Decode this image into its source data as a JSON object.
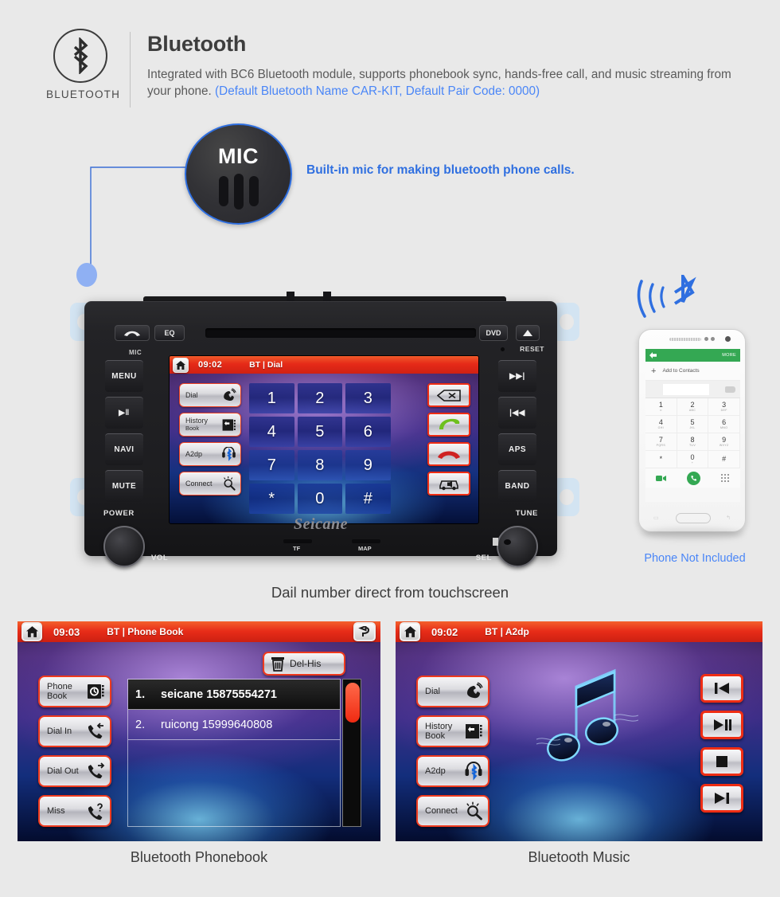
{
  "header": {
    "icon_name": "bluetooth-icon",
    "icon_word": "BLUETOOTH",
    "title": "Bluetooth",
    "desc_main": "Integrated with BC6 Bluetooth module, supports phonebook sync, hands-free call, and music streaming from your phone. ",
    "desc_accent": "(Default Bluetooth Name CAR-KIT, Default Pair Code: 0000)",
    "accent_color": "#4a86f7"
  },
  "mic": {
    "label": "MIC",
    "caption": "Built-in mic for making bluetooth phone calls.",
    "caption_color": "#2f6fe0"
  },
  "unit": {
    "brand": "Seicane",
    "caption": "Dail number direct from touchscreen",
    "mic_hole_label": "MIC",
    "reset_label": "RESET",
    "top_buttons": [
      {
        "name": "hangup-button",
        "label": ""
      },
      {
        "name": "eq-button",
        "label": "EQ"
      },
      {
        "name": "dvd-button",
        "label": "DVD"
      },
      {
        "name": "eject-button",
        "label": ""
      }
    ],
    "left_keys": [
      "MENU",
      "▶‖",
      "NAVI",
      "MUTE"
    ],
    "right_keys": [
      "▶▶|",
      "|◀◀",
      "APS",
      "BAND"
    ],
    "knob_left_top": "POWER",
    "knob_left_bottom": "VOL",
    "knob_right_top": "TUNE",
    "knob_right_bottom": "SEL",
    "slot_tf": "TF",
    "slot_map": "MAP",
    "screen": {
      "time": "09:02",
      "title": "BT | Dial",
      "home_icon": "home-icon",
      "fn_buttons": [
        {
          "label1": "Dial",
          "label2": "",
          "icon": "phone-ring-icon"
        },
        {
          "label1": "History",
          "label2": "Book",
          "icon": "history-book-icon"
        },
        {
          "label1": "A2dp",
          "label2": "",
          "icon": "headphone-bluetooth-icon"
        },
        {
          "label1": "Connect",
          "label2": "",
          "icon": "magnifier-search-icon"
        }
      ],
      "keypad": [
        "1",
        "2",
        "3",
        "4",
        "5",
        "6",
        "7",
        "8",
        "9",
        "*",
        "0",
        "#"
      ],
      "action_buttons": [
        {
          "icon": "backspace-icon"
        },
        {
          "icon": "call-answer-icon"
        },
        {
          "icon": "call-end-icon"
        },
        {
          "icon": "car-speaker-transfer-icon"
        }
      ]
    }
  },
  "phone": {
    "bt_wave_icon": "bluetooth-wireless-icon",
    "note": "Phone Not Included",
    "note_color": "#4a86f7",
    "screen": {
      "back_icon": "arrow-left-icon",
      "more_label": "MORE",
      "add_contacts": "Add to Contacts",
      "keys": [
        {
          "n": "1",
          "s": "∞"
        },
        {
          "n": "2",
          "s": "ABC"
        },
        {
          "n": "3",
          "s": "DEF"
        },
        {
          "n": "4",
          "s": "GHI"
        },
        {
          "n": "5",
          "s": "JKL"
        },
        {
          "n": "6",
          "s": "MNO"
        },
        {
          "n": "7",
          "s": "PQRS"
        },
        {
          "n": "8",
          "s": "TUV"
        },
        {
          "n": "9",
          "s": "WXYZ"
        },
        {
          "n": "*",
          "s": ""
        },
        {
          "n": "0",
          "s": "+"
        },
        {
          "n": "#",
          "s": ""
        }
      ],
      "bottom_icons": [
        "video-call-icon",
        "call-green-icon",
        "keypad-hide-icon"
      ]
    }
  },
  "panel_left": {
    "caption": "Bluetooth Phonebook",
    "time": "09:03",
    "title": "BT | Phone Book",
    "home_icon": "home-icon",
    "back_icon": "back-arrow-icon",
    "del_his_label": "Del-His",
    "del_his_icon": "trash-icon",
    "fn_buttons": [
      {
        "label1": "Phone",
        "label2": "Book",
        "icon": "phonebook-icon"
      },
      {
        "label1": "Dial In",
        "label2": "",
        "icon": "call-incoming-icon"
      },
      {
        "label1": "Dial Out",
        "label2": "",
        "icon": "call-outgoing-icon"
      },
      {
        "label1": "Miss",
        "label2": "",
        "icon": "call-missed-icon"
      }
    ],
    "contacts": [
      {
        "index": "1.",
        "text": "seicane 15875554271"
      },
      {
        "index": "2.",
        "text": "ruicong 15999640808"
      }
    ]
  },
  "panel_right": {
    "caption": "Bluetooth Music",
    "time": "09:02",
    "title": "BT | A2dp",
    "home_icon": "home-icon",
    "fn_buttons": [
      {
        "label1": "Dial",
        "label2": "",
        "icon": "phone-ring-icon"
      },
      {
        "label1": "History",
        "label2": "Book",
        "icon": "history-book-icon"
      },
      {
        "label1": "A2dp",
        "label2": "",
        "icon": "headphone-bluetooth-icon"
      },
      {
        "label1": "Connect",
        "label2": "",
        "icon": "magnifier-search-icon"
      }
    ],
    "action_buttons": [
      {
        "icon": "previous-track-icon"
      },
      {
        "icon": "play-pause-icon"
      },
      {
        "icon": "stop-icon"
      },
      {
        "icon": "next-track-icon"
      }
    ],
    "art_icon": "music-note-icon"
  }
}
